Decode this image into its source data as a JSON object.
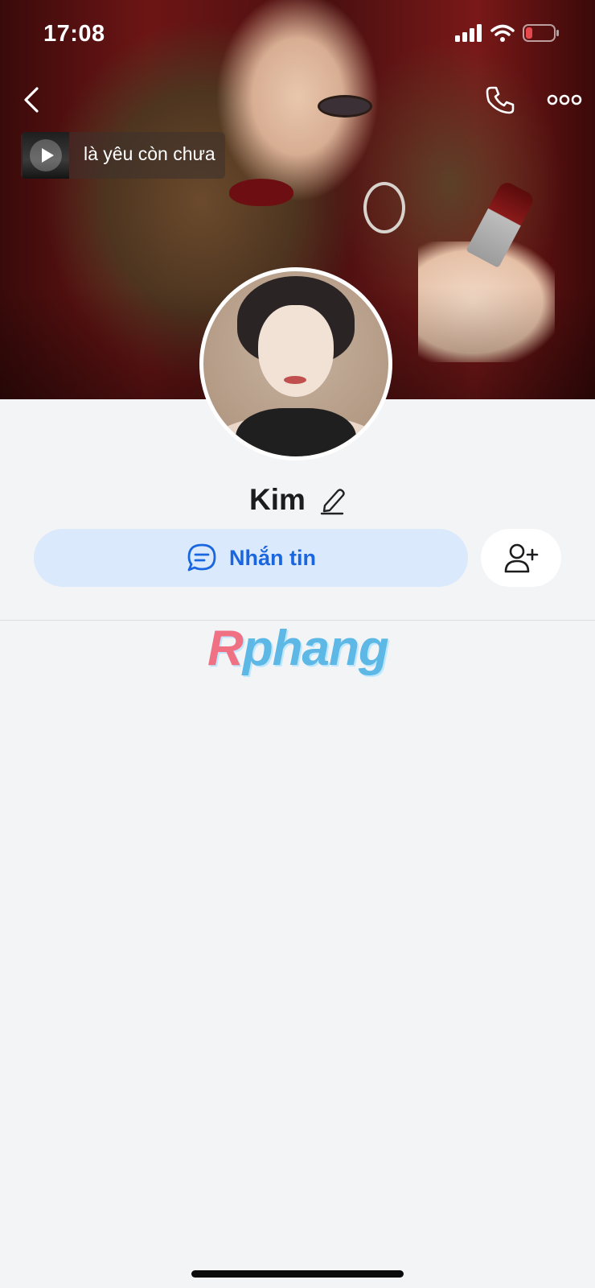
{
  "status_bar": {
    "time": "17:08"
  },
  "music": {
    "title": "là yêu còn chưa"
  },
  "profile": {
    "name": "Kim"
  },
  "actions": {
    "message_label": "Nhắn tin"
  },
  "watermark": {
    "text_first": "R",
    "text_rest": "phang"
  },
  "colors": {
    "accent": "#1a66e0",
    "accent_bg": "#dbe9fd",
    "battery_low": "#e5484d"
  }
}
